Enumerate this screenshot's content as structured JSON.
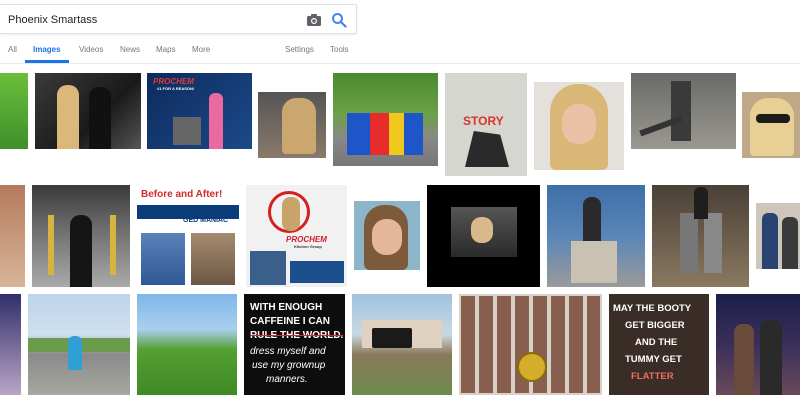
{
  "search": {
    "query": "Phoenix Smartass"
  },
  "tabs": [
    {
      "label": "All",
      "active": false
    },
    {
      "label": "Images",
      "active": true
    },
    {
      "label": "Videos",
      "active": false
    },
    {
      "label": "News",
      "active": false
    },
    {
      "label": "Maps",
      "active": false
    },
    {
      "label": "More",
      "active": false
    },
    {
      "label": "Settings",
      "active": false
    },
    {
      "label": "Tools",
      "active": false
    }
  ],
  "colors": {
    "accent": "#1a73e8",
    "tab_text": "#777777",
    "prochem_red": "#cc1f2d",
    "flatter_red": "#f26b5b"
  },
  "image_texts": {
    "prochem_booth": "PROCHEM",
    "prochem_sub": "#1 FOR A REASON!",
    "story_book": "STORY",
    "before_after": "Before and After!",
    "ged_maniac": "GED MANIAC",
    "prochem_promo": "PROCHEM",
    "prochem_promo_sub": "Kitchen Group",
    "caffeine": [
      "WITH ENOUGH",
      "CAFFEINE I CAN",
      "RULE THE WORLD.",
      "dress myself and",
      "use my grownup",
      "manners."
    ],
    "booty": [
      "MAY THE BOOTY",
      "GET BIGGER",
      "AND THE",
      "TUMMY GET",
      "FLATTER"
    ]
  }
}
